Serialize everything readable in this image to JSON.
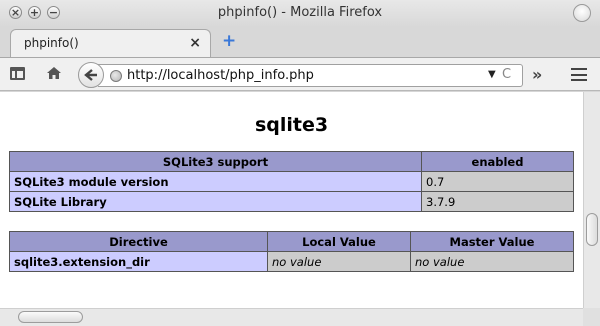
{
  "window": {
    "title": "phpinfo() - Mozilla Firefox"
  },
  "tab": {
    "label": "phpinfo()",
    "close": "×",
    "new_tab": "+"
  },
  "toolbar": {
    "back": "🡐",
    "url": "http://localhost/php_info.php",
    "dropdown": "▼",
    "reload": "C",
    "overflow": "»"
  },
  "page": {
    "heading": "sqlite3",
    "table1": {
      "headers": [
        "SQLite3 support",
        "enabled"
      ],
      "rows": [
        [
          "SQLite3 module version",
          "0.7"
        ],
        [
          "SQLite Library",
          "3.7.9"
        ]
      ]
    },
    "table2": {
      "headers": [
        "Directive",
        "Local Value",
        "Master Value"
      ],
      "rows": [
        [
          "sqlite3.extension_dir",
          "no value",
          "no value"
        ]
      ]
    }
  },
  "colors": {
    "header_bg": "#9999cc",
    "label_bg": "#ccccff",
    "value_bg": "#cccccc"
  }
}
